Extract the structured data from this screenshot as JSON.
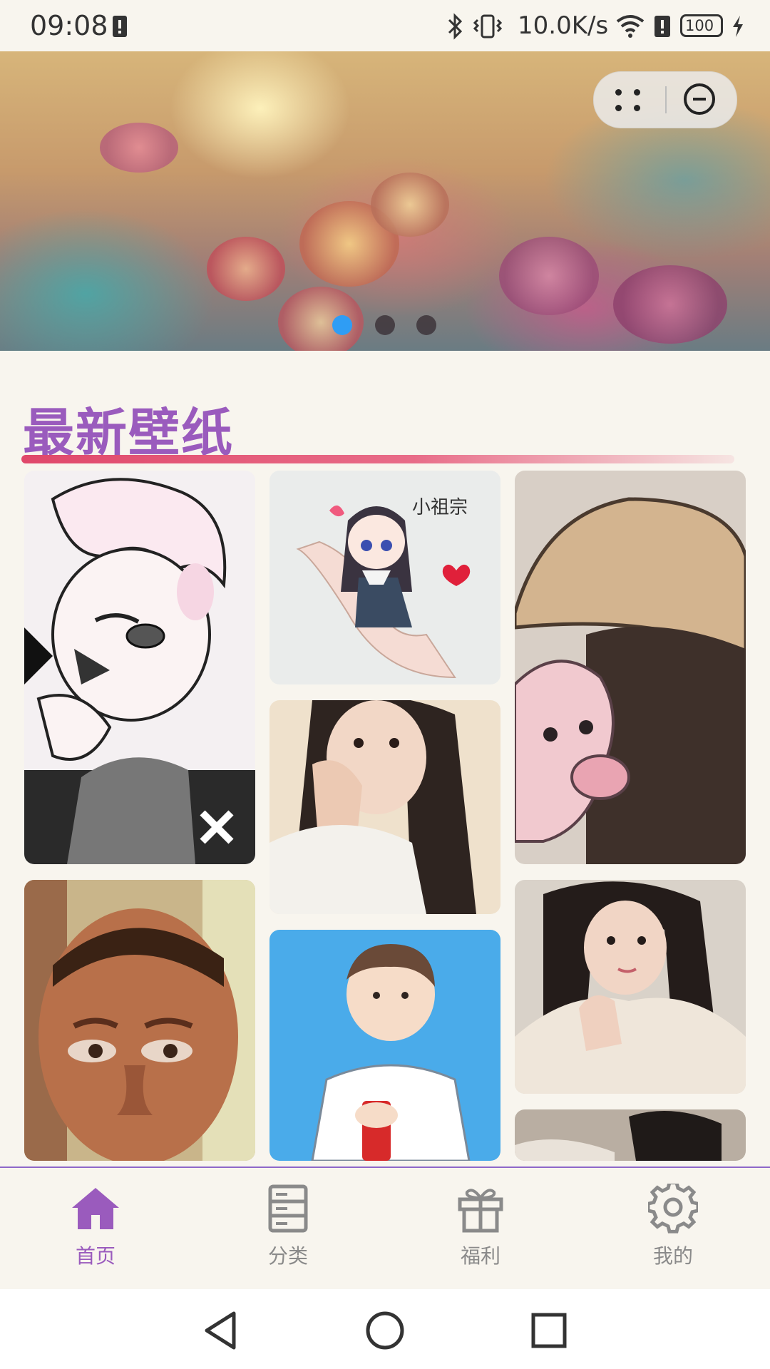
{
  "status_bar": {
    "time": "09:08",
    "net_speed": "10.0K/s",
    "battery": "100",
    "icons": [
      "sim-alert-icon",
      "bluetooth-icon",
      "vibrate-icon",
      "wifi-icon",
      "sim-alert-icon",
      "battery-icon",
      "charging-icon"
    ]
  },
  "banner": {
    "active_index": 0,
    "indicator_count": 3,
    "capsule_icons": [
      "more-dots-icon",
      "close-circle-icon"
    ],
    "colors": {
      "active": "#2f9df4",
      "inactive": "#3a2f36"
    }
  },
  "section": {
    "title": "最新壁纸"
  },
  "wallpapers": {
    "columns": [
      [
        "manga-white-hair-boy",
        "photo-bald-man"
      ],
      [
        "chibi-girl-on-hand",
        "photo-long-hair-girl",
        "cartoon-boy-with-cola"
      ],
      [
        "hat-girl-with-plush",
        "photo-girl-in-hoodie",
        "photo-dark-hair-partial"
      ]
    ],
    "chibi_caption": "小祖宗"
  },
  "bottom_nav": {
    "active": "home",
    "colors": {
      "active": "#9a5bbd",
      "inactive": "#8a8a8a"
    },
    "items": [
      {
        "key": "home",
        "label": "首页",
        "icon": "home-icon"
      },
      {
        "key": "category",
        "label": "分类",
        "icon": "category-icon"
      },
      {
        "key": "welfare",
        "label": "福利",
        "icon": "gift-icon"
      },
      {
        "key": "mine",
        "label": "我的",
        "icon": "settings-gear-icon"
      }
    ]
  },
  "system_nav": {
    "icons": [
      "back-icon",
      "home-circle-icon",
      "recents-icon"
    ]
  }
}
